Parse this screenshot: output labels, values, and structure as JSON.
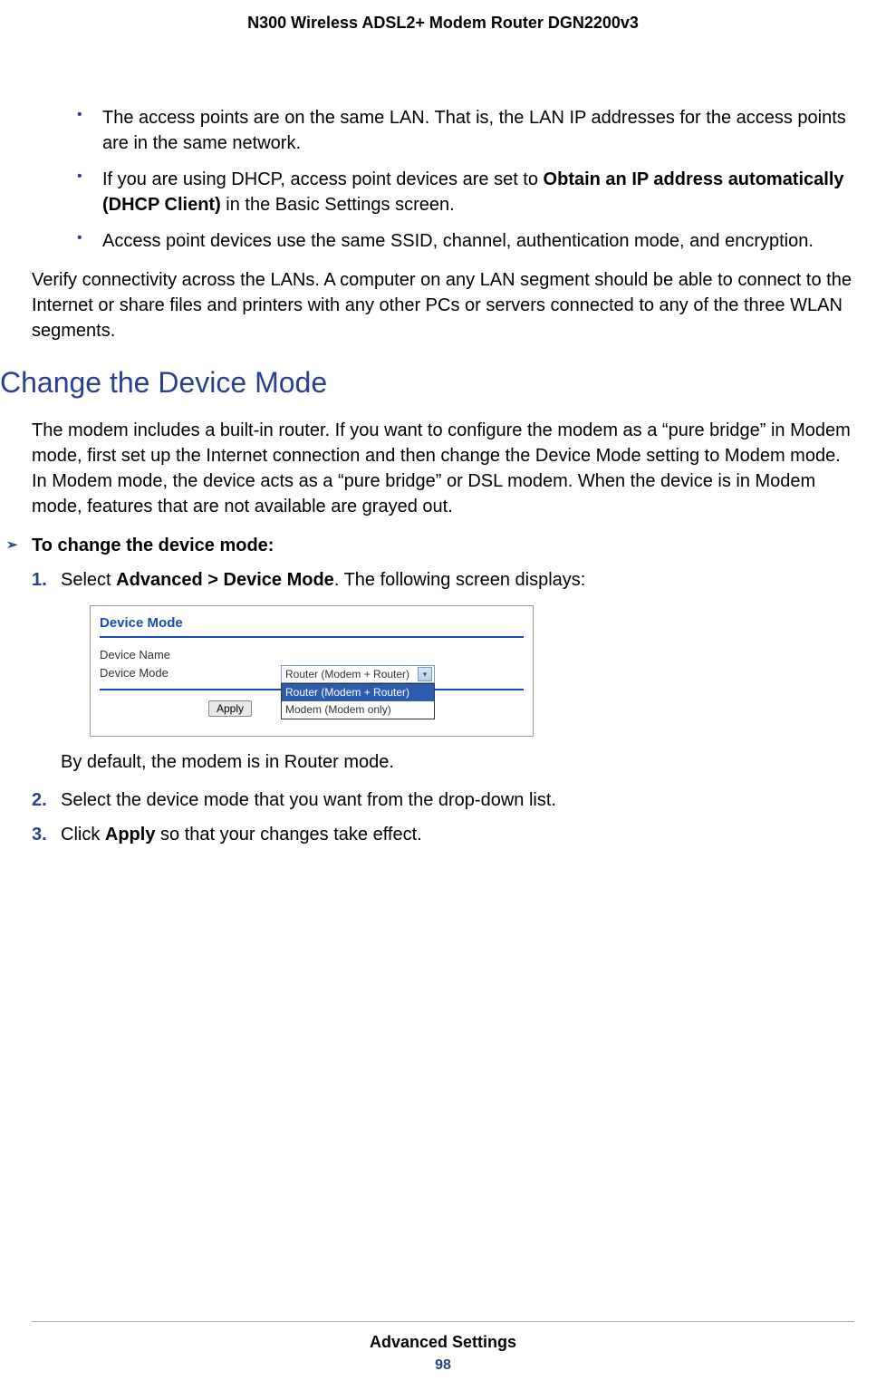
{
  "header": {
    "title": "N300 Wireless ADSL2+ Modem Router DGN2200v3"
  },
  "bullets": {
    "b1": "The access points are on the same LAN. That is, the LAN IP addresses for the access points are in the same network.",
    "b2_pre": "If you are using DHCP, access point devices are set to ",
    "b2_bold": "Obtain an IP address automatically (DHCP Client)",
    "b2_post": " in the Basic Settings screen.",
    "b3": "Access point devices use the same SSID, channel, authentication mode, and encryption."
  },
  "para1": "Verify connectivity across the LANs. A computer on any LAN segment should be able to connect to the Internet or share files and printers with any other PCs or servers connected to any of the three WLAN segments.",
  "section_heading": "Change the Device Mode",
  "para2": "The modem includes a built-in router. If you want to configure the modem as a “pure bridge” in Modem mode, first set up the Internet connection and then change the Device Mode setting to Modem mode. In Modem mode, the device acts as a “pure bridge” or DSL modem. When the device is in Modem mode, features that are not available are grayed out.",
  "proc_heading": "To change the device mode:",
  "steps": {
    "s1_num": "1.",
    "s1_pre": "Select ",
    "s1_bold": "Advanced > Device Mode",
    "s1_post": ". The following screen displays:",
    "s1_sub": "By default, the modem is in Router mode.",
    "s2_num": "2.",
    "s2_text": "Select the device mode that you want from the drop-down list.",
    "s3_num": "3.",
    "s3_pre": "Click ",
    "s3_bold": "Apply",
    "s3_post": " so that your changes take effect."
  },
  "panel": {
    "title": "Device Mode",
    "label_name": "Device Name",
    "label_mode": "Device Mode",
    "select_value": "Router (Modem + Router)",
    "option1": "Router (Modem + Router)",
    "option2": "Modem (Modem only)",
    "apply": "Apply"
  },
  "footer": {
    "section": "Advanced Settings",
    "page": "98"
  }
}
